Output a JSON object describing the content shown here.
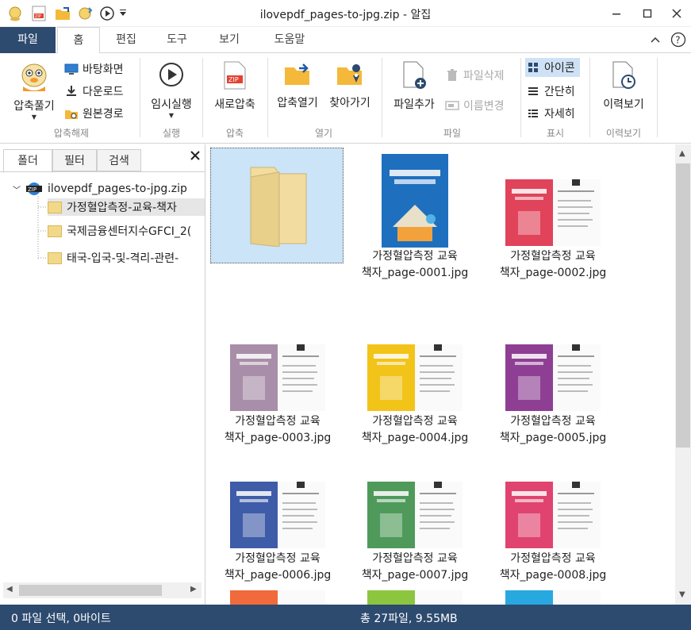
{
  "window": {
    "title": "ilovepdf_pages-to-jpg.zip - 알집",
    "minimize_icon": "minimize-icon",
    "maximize_icon": "maximize-icon",
    "close_icon": "close-icon"
  },
  "ribbon_tabs": [
    "파일",
    "홈",
    "편집",
    "도구",
    "보기",
    "도움말"
  ],
  "ribbon": {
    "extract": {
      "big": "압축풀기",
      "desktop": "바탕화면",
      "download": "다운로드",
      "original": "원본경로",
      "group": "압축해제"
    },
    "run": {
      "big": "임시실행",
      "group": "실행"
    },
    "compress": {
      "big": "새로압축",
      "group": "압축"
    },
    "open": {
      "open_zip": "압축열기",
      "find": "찾아가기",
      "group": "열기"
    },
    "file": {
      "add": "파일추가",
      "delete": "파일삭제",
      "rename": "이름변경",
      "group": "파일"
    },
    "view": {
      "icon": "아이콘",
      "simple": "간단히",
      "detail": "자세히",
      "group": "표시"
    },
    "history": {
      "big": "이력보기",
      "group": "이력보기"
    }
  },
  "left_panel": {
    "tabs": [
      "폴더",
      "필터",
      "검색"
    ],
    "tree": {
      "root": "ilovepdf_pages-to-jpg.zip",
      "children": [
        "가정혈압측정-교육-책자",
        "국제금융센터지수GFCI_2(",
        "태국-입국-및-격리-관련-"
      ]
    }
  },
  "files": [
    {
      "line1": "",
      "line2": "",
      "color": "#f2dca0"
    },
    {
      "line1": "가정혈압측정 교육",
      "line2": "책자_page-0001.jpg",
      "color": "#1f6fbf"
    },
    {
      "line1": "가정혈압측정 교육",
      "line2": "책자_page-0002.jpg",
      "color": "#e0435a"
    },
    {
      "line1": "가정혈압측정 교육",
      "line2": "책자_page-0003.jpg",
      "color": "#a88ea8"
    },
    {
      "line1": "가정혈압측정 교육",
      "line2": "책자_page-0004.jpg",
      "color": "#f2c419"
    },
    {
      "line1": "가정혈압측정 교육",
      "line2": "책자_page-0005.jpg",
      "color": "#8e3f94"
    },
    {
      "line1": "가정혈압측정 교육",
      "line2": "책자_page-0006.jpg",
      "color": "#3f5ca8"
    },
    {
      "line1": "가정혈압측정 교육",
      "line2": "책자_page-0007.jpg",
      "color": "#4f9a5a"
    },
    {
      "line1": "가정혈압측정 교육",
      "line2": "책자_page-0008.jpg",
      "color": "#e0436f"
    }
  ],
  "partial_row_colors": [
    "#f06a3b",
    "#8cc63f",
    "#27a9e0"
  ],
  "status": {
    "left": "0 파일 선택, 0바이트",
    "center": "총 27파일, 9.55MB"
  }
}
